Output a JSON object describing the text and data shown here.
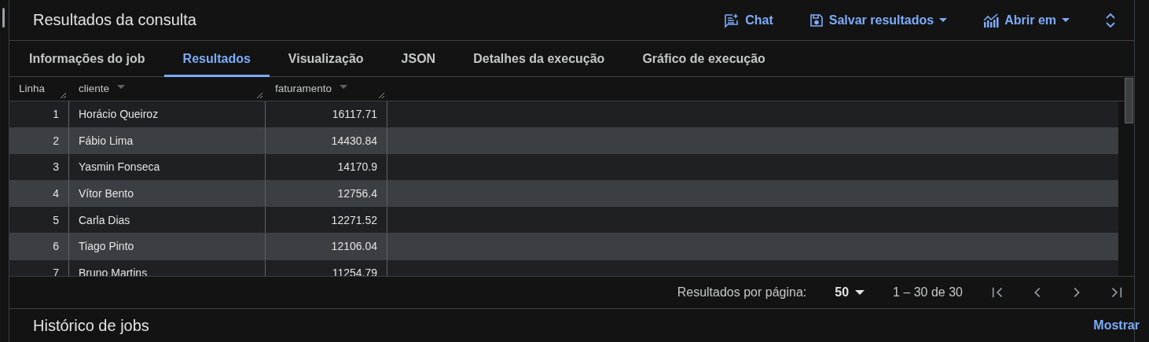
{
  "panel": {
    "title": "Resultados da consulta",
    "actions": [
      {
        "kind": "chat",
        "label": "Chat",
        "dropdown": false
      },
      {
        "kind": "save",
        "label": "Salvar resultados",
        "dropdown": true
      },
      {
        "kind": "open",
        "label": "Abrir em",
        "dropdown": true
      }
    ]
  },
  "tabs": [
    {
      "label": "Informações do job",
      "selected": false
    },
    {
      "label": "Resultados",
      "selected": true
    },
    {
      "label": "Visualização",
      "selected": false
    },
    {
      "label": "JSON",
      "selected": false
    },
    {
      "label": "Detalhes da execução",
      "selected": false
    },
    {
      "label": "Gráfico de execução",
      "selected": false
    }
  ],
  "table": {
    "columns": [
      {
        "label": "Linha",
        "menu": false
      },
      {
        "label": "cliente",
        "menu": true
      },
      {
        "label": "faturamento",
        "menu": true
      }
    ],
    "rows": [
      [
        "1",
        "Horácio Queiroz",
        "16117.71"
      ],
      [
        "2",
        "Fábio Lima",
        "14430.84"
      ],
      [
        "3",
        "Yasmin Fonseca",
        "14170.9"
      ],
      [
        "4",
        "Vítor Bento",
        "12756.4"
      ],
      [
        "5",
        "Carla Dias",
        "12271.52"
      ],
      [
        "6",
        "Tiago Pinto",
        "12106.04"
      ],
      [
        "7",
        "Bruno Martins",
        "11254.79"
      ]
    ]
  },
  "pager": {
    "label": "Resultados por página:",
    "page_size": "50",
    "range": "1 – 30 de 30"
  },
  "history": {
    "title": "Histórico de jobs",
    "action": "Mostrar"
  }
}
